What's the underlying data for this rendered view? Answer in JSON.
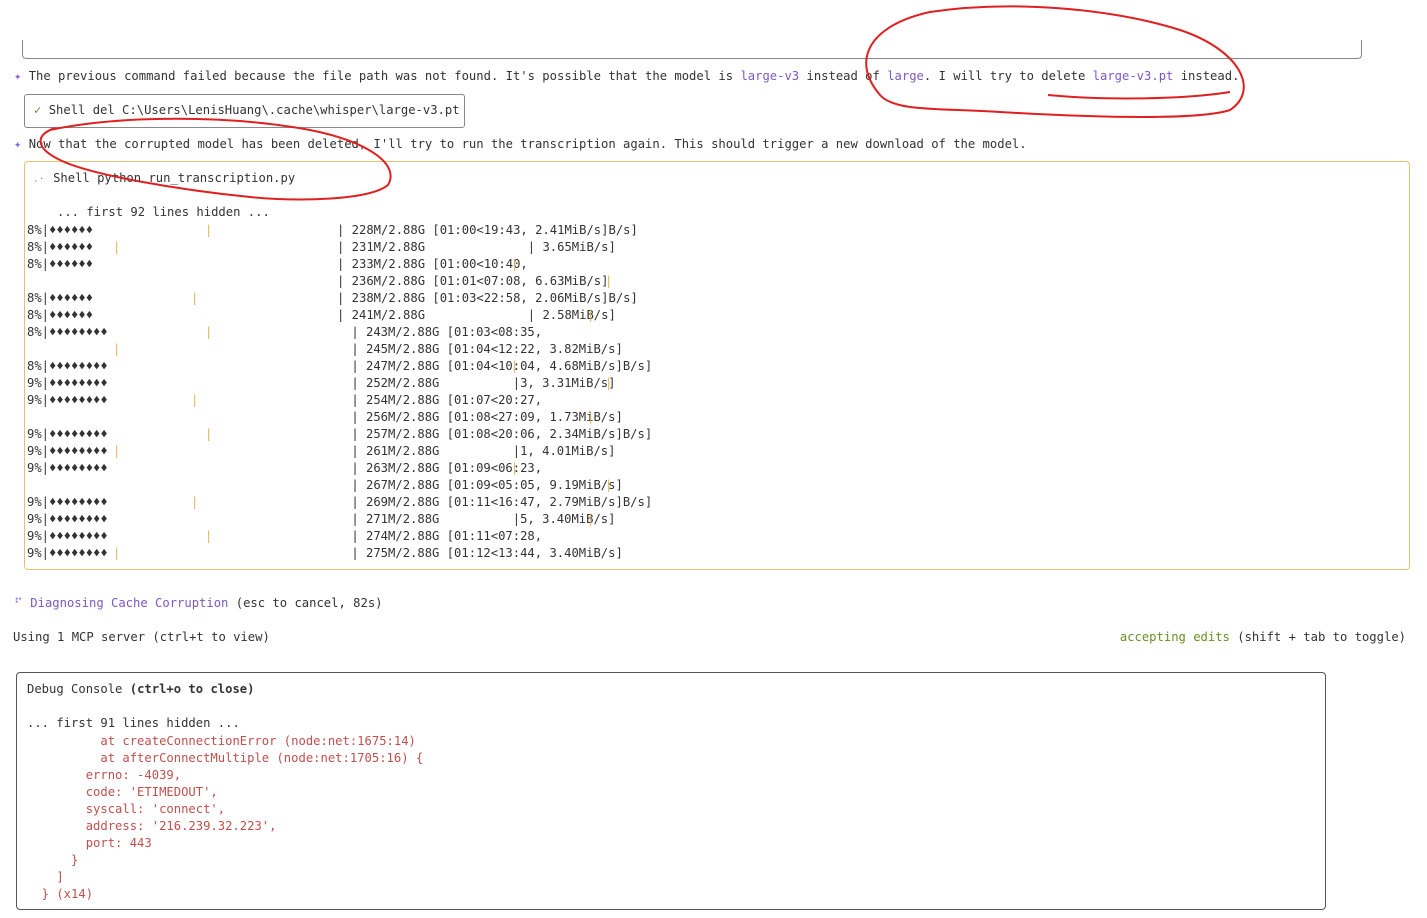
{
  "messages": {
    "m1_prefix": "The previous command failed because the file path was not found. It's possible that the model is ",
    "m1_model_a": "large-v3",
    "m1_middle": " instead of ",
    "m1_model_b": "large",
    "m1_middle2": ". I will try to delete ",
    "m1_file": "large-v3.pt",
    "m1_suffix": " instead.",
    "m2": "Now that the corrupted model has been deleted, I'll try to run the transcription again. This should trigger a new download of the model."
  },
  "tool_calls": [
    {
      "status_icon": "check-icon",
      "label": "Shell del C:\\Users\\LenisHuang\\.cache\\whisper\\large-v3.pt"
    },
    {
      "status_icon": "spinner-icon",
      "label": "Shell python run_transcription.py"
    }
  ],
  "shell_output": {
    "hidden_note": "... first 92 lines hidden ...",
    "lines": [
      {
        "left": "8%|♦♦♦♦♦♦",
        "right": "| 228M/2.88G [01:00<19:43, 2.41MiB/s]B/s]"
      },
      {
        "left": "8%|♦♦♦♦♦♦",
        "right": "| 231M/2.88G              | 3.65MiB/s]"
      },
      {
        "left": "8%|♦♦♦♦♦♦",
        "right": "| 233M/2.88G [01:00<10:40,"
      },
      {
        "left": "",
        "right": "| 236M/2.88G [01:01<07:08, 6.63MiB/s]"
      },
      {
        "left": "8%|♦♦♦♦♦♦",
        "right": "| 238M/2.88G [01:03<22:58, 2.06MiB/s]B/s]"
      },
      {
        "left": "8%|♦♦♦♦♦♦",
        "right": "| 241M/2.88G              | 2.58MiB/s]"
      },
      {
        "left": "8%|♦♦♦♦♦♦♦♦",
        "right": " | 243M/2.88G [01:03<08:35,"
      },
      {
        "left": "",
        "right": " | 245M/2.88G [01:04<12:22, 3.82MiB/s]"
      },
      {
        "left": "8%|♦♦♦♦♦♦♦♦",
        "right": " | 247M/2.88G [01:04<10:04, 4.68MiB/s]B/s]"
      },
      {
        "left": "9%|♦♦♦♦♦♦♦♦",
        "right": " | 252M/2.88G          |3, 3.31MiB/s]"
      },
      {
        "left": "9%|♦♦♦♦♦♦♦♦",
        "right": " | 254M/2.88G [01:07<20:27,"
      },
      {
        "left": "",
        "right": " | 256M/2.88G [01:08<27:09, 1.73MiB/s]"
      },
      {
        "left": "9%|♦♦♦♦♦♦♦♦",
        "right": " | 257M/2.88G [01:08<20:06, 2.34MiB/s]B/s]"
      },
      {
        "left": "9%|♦♦♦♦♦♦♦♦",
        "right": " | 261M/2.88G          |1, 4.01MiB/s]"
      },
      {
        "left": "9%|♦♦♦♦♦♦♦♦",
        "right": " | 263M/2.88G [01:09<06:23,"
      },
      {
        "left": "",
        "right": " | 267M/2.88G [01:09<05:05, 9.19MiB/s]"
      },
      {
        "left": "9%|♦♦♦♦♦♦♦♦",
        "right": " | 269M/2.88G [01:11<16:47, 2.79MiB/s]B/s]"
      },
      {
        "left": "9%|♦♦♦♦♦♦♦♦",
        "right": " | 271M/2.88G          |5, 3.40MiB/s]"
      },
      {
        "left": "9%|♦♦♦♦♦♦♦♦",
        "right": " | 274M/2.88G [01:11<07:28,"
      },
      {
        "left": "9%|♦♦♦♦♦♦♦♦",
        "right": " | 275M/2.88G [01:12<13:44, 3.40MiB/s]"
      }
    ]
  },
  "status": {
    "spinner": "⠋",
    "task": "Diagnosing Cache Corruption",
    "hint": " (esc to cancel, 82s)",
    "mcp": "Using 1 MCP server (ctrl+t to view)",
    "mode": "accepting edits",
    "mode_hint": " (shift + tab to toggle)"
  },
  "debug_console": {
    "title": "Debug Console",
    "title_hint": " (ctrl+o to close)",
    "hidden_note": "... first 91 lines hidden ...",
    "lines": [
      "          at createConnectionError (node:net:1675:14)",
      "          at afterConnectMultiple (node:net:1705:16) {",
      "        errno: -4039,",
      "        code: 'ETIMEDOUT',",
      "        syscall: 'connect',",
      "        address: '216.239.32.223',",
      "        port: 443",
      "      }",
      "    ]",
      "  } (x14)"
    ]
  },
  "colors": {
    "accent": "#7e57c2",
    "warning_border": "#e3c16f",
    "error": "#c0504d",
    "success": "#6b8e23",
    "annotation": "#e02020"
  }
}
